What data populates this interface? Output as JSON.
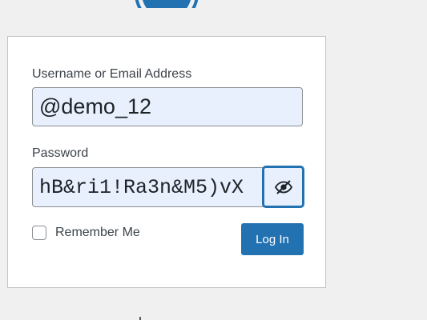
{
  "logo": {
    "icon": "wordpress-logo-icon",
    "color": "#2271b1"
  },
  "form": {
    "username_label": "Username or Email Address",
    "username_value": "@demo_12",
    "password_label": "Password",
    "password_value": "hB&ri1!Ra3n&M5)vX",
    "toggle_icon": "eye-slash-icon",
    "remember_label": "Remember Me",
    "remember_checked": false,
    "login_label": "Log In"
  },
  "colors": {
    "accent": "#2271b1",
    "background": "#f0f0f1",
    "autofill": "#e8f0fe"
  }
}
